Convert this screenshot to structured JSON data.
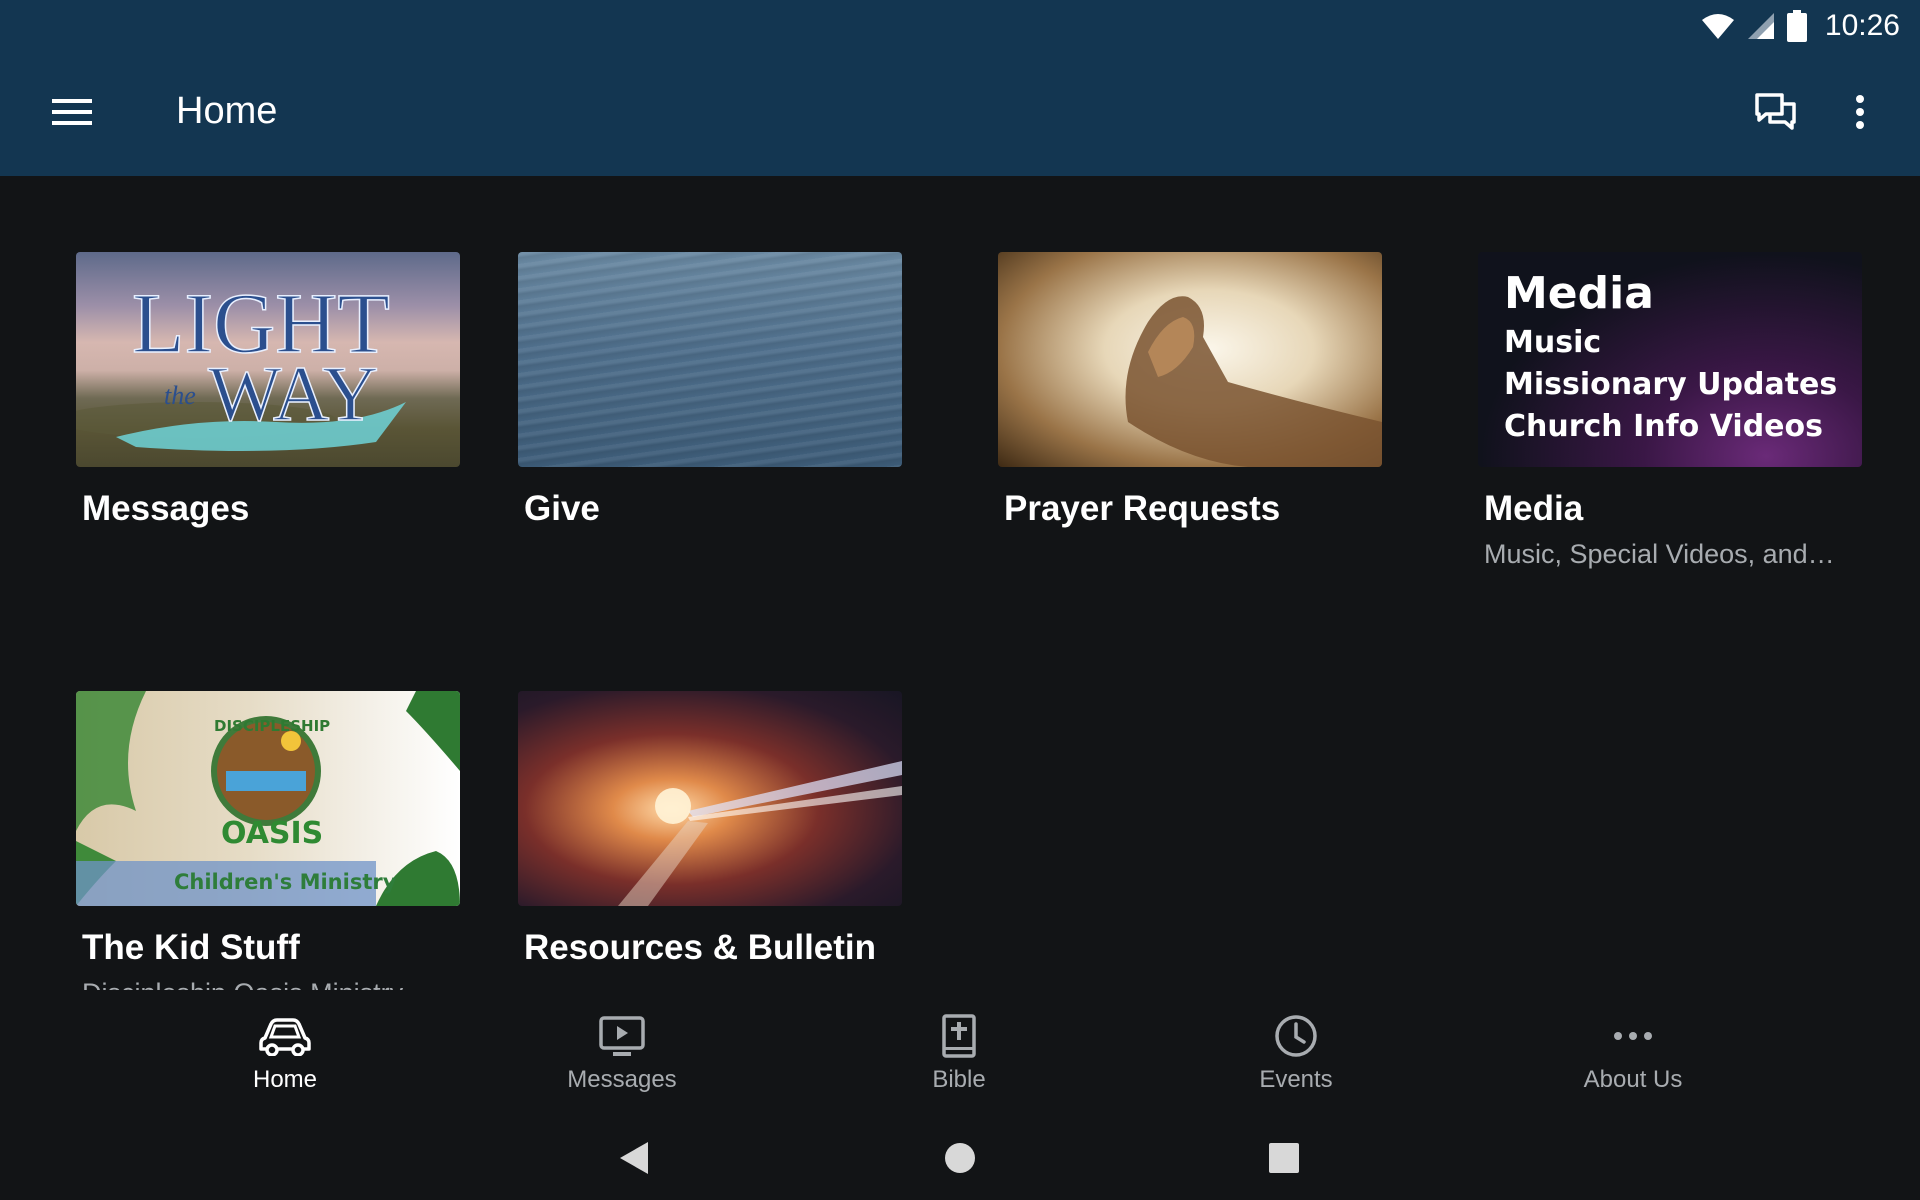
{
  "status_bar": {
    "time": "10:26",
    "icons": [
      "wifi-icon",
      "signal-icon",
      "battery-icon"
    ]
  },
  "app_bar": {
    "title": "Home",
    "menu_icon": "hamburger-menu-icon",
    "chat_icon": "chat-bubbles-icon",
    "more_icon": "more-vertical-icon",
    "background_color": "#133651"
  },
  "tiles": [
    {
      "title": "Messages",
      "subtitle": "",
      "thumbnail": {
        "lines": [
          "LIGHT",
          "the",
          "WAY"
        ]
      }
    },
    {
      "title": "Give",
      "subtitle": ""
    },
    {
      "title": "Prayer Requests",
      "subtitle": ""
    },
    {
      "title": "Media",
      "subtitle": "Music, Special Videos, and…",
      "thumbnail": {
        "heading": "Media",
        "lines": [
          "Music",
          "Missionary Updates",
          "Church Info Videos"
        ]
      }
    },
    {
      "title": "The Kid Stuff",
      "subtitle": "Discipleship Oasis Ministry",
      "thumbnail": {
        "top": "DISCIPLESHIP",
        "middle": "OASIS",
        "bottom": "Children's Ministry"
      }
    },
    {
      "title": "Resources & Bulletin",
      "subtitle": ""
    }
  ],
  "bottom_nav": {
    "items": [
      {
        "label": "Home",
        "icon": "car-icon",
        "active": true
      },
      {
        "label": "Messages",
        "icon": "video-play-icon",
        "active": false
      },
      {
        "label": "Bible",
        "icon": "bible-icon",
        "active": false
      },
      {
        "label": "Events",
        "icon": "clock-icon",
        "active": false
      },
      {
        "label": "About Us",
        "icon": "more-horizontal-icon",
        "active": false
      }
    ]
  },
  "system_nav": {
    "icons": [
      "back-icon",
      "home-icon",
      "recents-icon"
    ]
  },
  "colors": {
    "background": "#121416",
    "secondary_text": "#a8acb0"
  }
}
